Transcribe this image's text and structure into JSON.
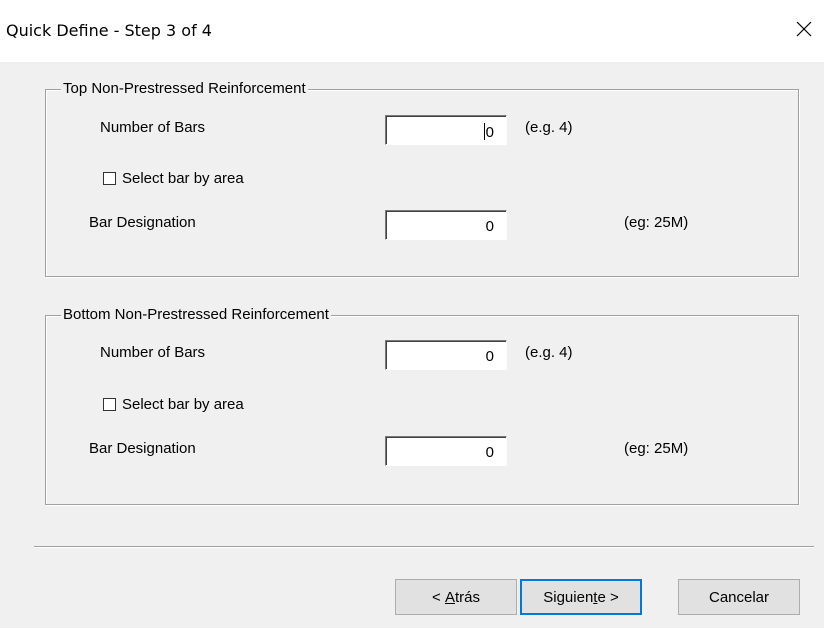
{
  "window": {
    "title": "Quick Define - Step 3 of 4",
    "close_glyph": "close-icon"
  },
  "top_group": {
    "title": "Top Non-Prestressed Reinforcement",
    "num_bars_label": "Number of Bars",
    "num_bars_value": "0",
    "num_bars_hint": "(e.g.  4)",
    "select_by_area_label": "Select bar by area",
    "select_by_area_checked": false,
    "bar_designation_label": "Bar Designation",
    "bar_designation_value": "0",
    "bar_designation_hint": "(eg: 25M)"
  },
  "bottom_group": {
    "title": "Bottom Non-Prestressed Reinforcement",
    "num_bars_label": "Number of Bars",
    "num_bars_value": "0",
    "num_bars_hint": "(e.g. 4)",
    "select_by_area_label": "Select bar by area",
    "select_by_area_checked": false,
    "bar_designation_label": "Bar Designation",
    "bar_designation_value": "0",
    "bar_designation_hint": "(eg: 25M)"
  },
  "buttons": {
    "back_prefix": "< ",
    "back_mnemonic": "A",
    "back_rest": "trás",
    "next_prefix": "Siguien",
    "next_mnemonic": "t",
    "next_rest": "e >",
    "cancel": "Cancelar"
  },
  "colors": {
    "dialog_bg": "#f0f0f0",
    "titlebar_bg": "#ffffff",
    "default_button_border": "#0078d7"
  }
}
